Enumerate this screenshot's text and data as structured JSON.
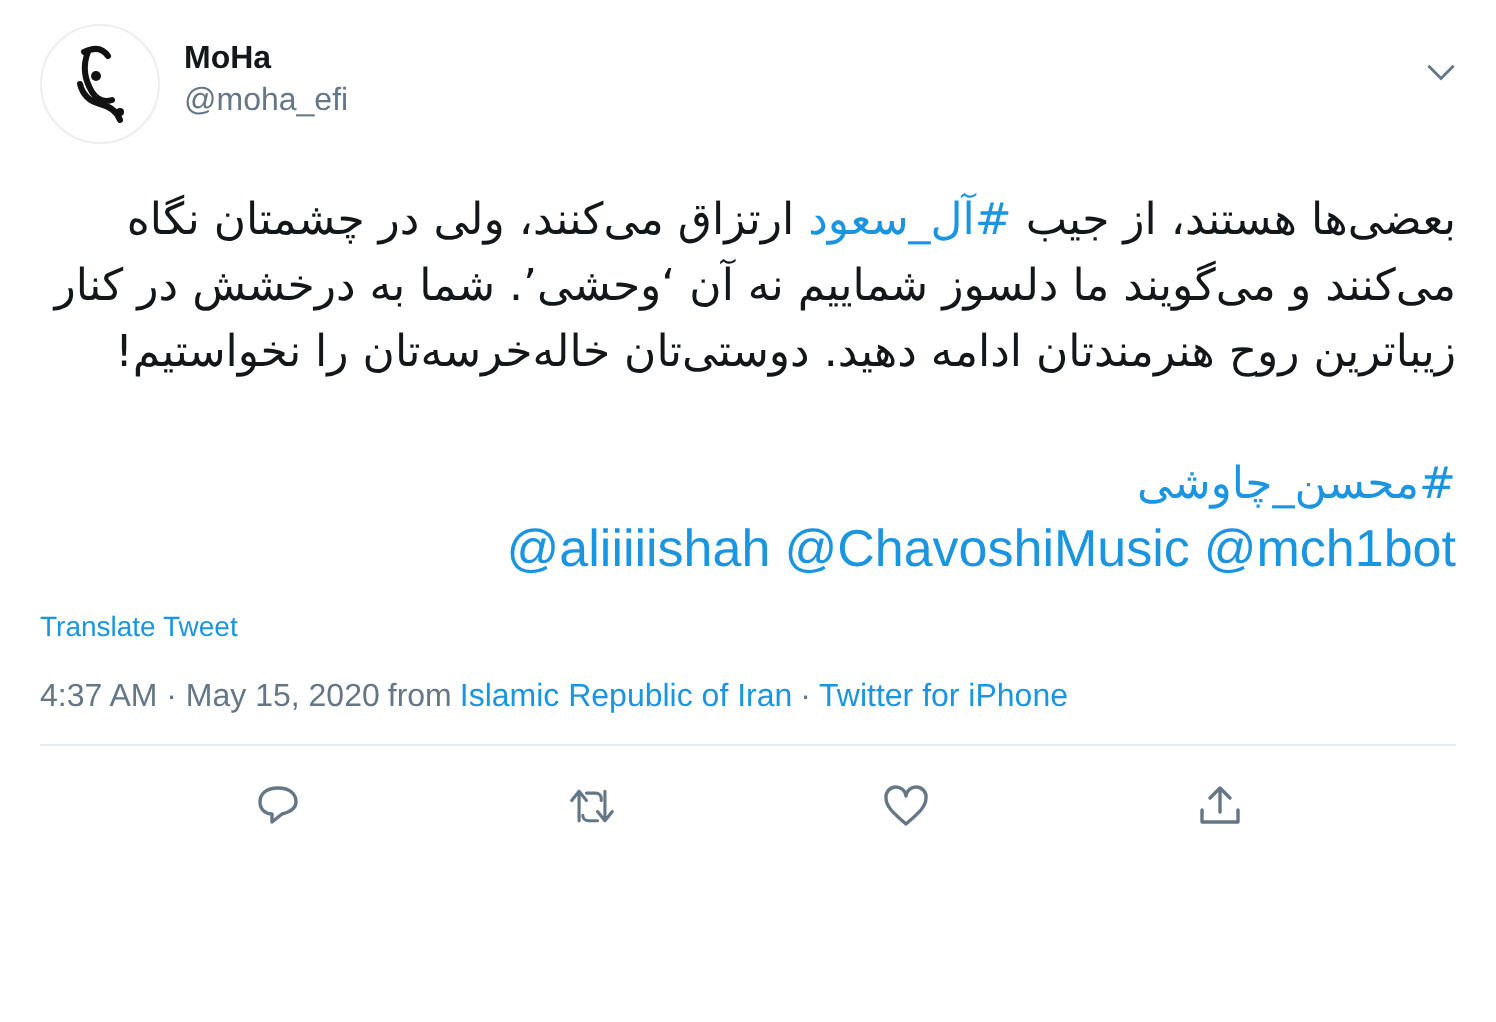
{
  "author": {
    "name": "MoHa",
    "handle": "@moha_efi"
  },
  "body": {
    "before": "بعضی‌ها هستند، از جیب ",
    "hashtag": "#آل_سعود",
    "after": " ارتزاق می‌کنند، ولی در چشمتان نگاه می‌کنند و می‌گویند ما دلسوز شماییم نه آن ‘وحشی’. شما به درخشش در کنار زیباترین روح هنرمندتان ادامه دهید. دوستی‌تان خاله‌خرسه‌تان را نخواستیم!"
  },
  "hashtag_line": "#محسن_چاوشی",
  "mentions": [
    "@mch1bot",
    "@ChavoshiMusic",
    "@aliiiiishah"
  ],
  "translate": "Translate Tweet",
  "meta": {
    "time": "4:37 AM · May 15, 2020",
    "from": "from",
    "location": "Islamic Republic of Iran",
    "separator": "·",
    "source": "Twitter for iPhone"
  }
}
